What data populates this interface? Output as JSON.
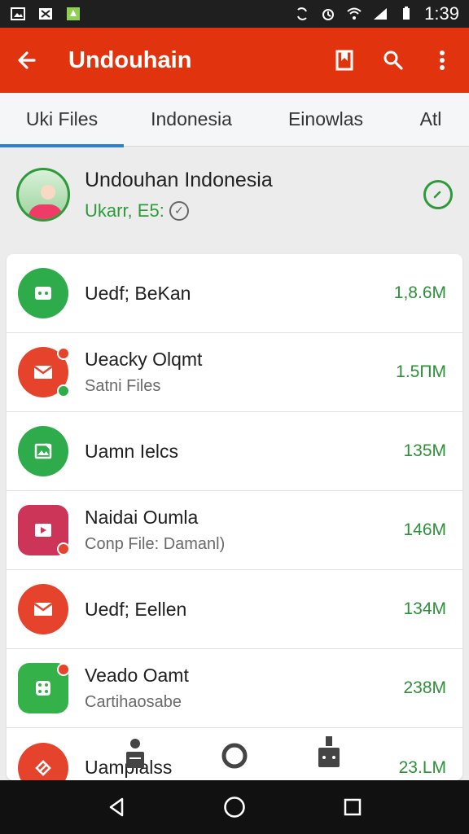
{
  "status_bar": {
    "time": "1:39",
    "left_icons": [
      "image-icon",
      "tools-icon",
      "android-icon"
    ],
    "right_icons": [
      "sync-icon",
      "alarm-icon",
      "wifi-icon",
      "signal-icon",
      "battery-icon"
    ]
  },
  "app_bar": {
    "title": "Undouhain",
    "actions": [
      "bookmark-icon",
      "search-icon",
      "more-vertical-icon"
    ]
  },
  "tabs": [
    {
      "label": "Uki Files",
      "active": true
    },
    {
      "label": "Indonesia",
      "active": false
    },
    {
      "label": "Einowlas",
      "active": false
    },
    {
      "label": "Atl",
      "active": false
    }
  ],
  "profile": {
    "name": "Undouhan Indonesia",
    "subtitle": "Ukarr, E5:",
    "action_icon": "edit-circle-icon"
  },
  "items": [
    {
      "title": "Uedf; BeKan",
      "subtitle": "",
      "size": "1,8.6M",
      "icon": "folder-chat-icon"
    },
    {
      "title": "Ueacky Olqmt",
      "subtitle": "Satni Files",
      "size": "1.5ΠM",
      "icon": "mail-icon"
    },
    {
      "title": "Uamn Ielcs",
      "subtitle": "",
      "size": "135M",
      "icon": "image-edit-icon"
    },
    {
      "title": "Naidai Oumla",
      "subtitle": "Conp File: Damanl)",
      "size": "146M",
      "icon": "video-icon"
    },
    {
      "title": "Uedf; Eellen",
      "subtitle": "",
      "size": "134M",
      "icon": "mail-icon"
    },
    {
      "title": "Veado Oamt",
      "subtitle": "Cartihaosabe",
      "size": "238M",
      "icon": "dice-icon"
    },
    {
      "title": "Uamplalss",
      "subtitle": "",
      "size": "23.LM",
      "icon": "tag-icon"
    }
  ],
  "colors": {
    "app_bar": "#e2330f",
    "accent": "#2f7fd0",
    "green": "#2d9b39",
    "red": "#e6432c"
  }
}
